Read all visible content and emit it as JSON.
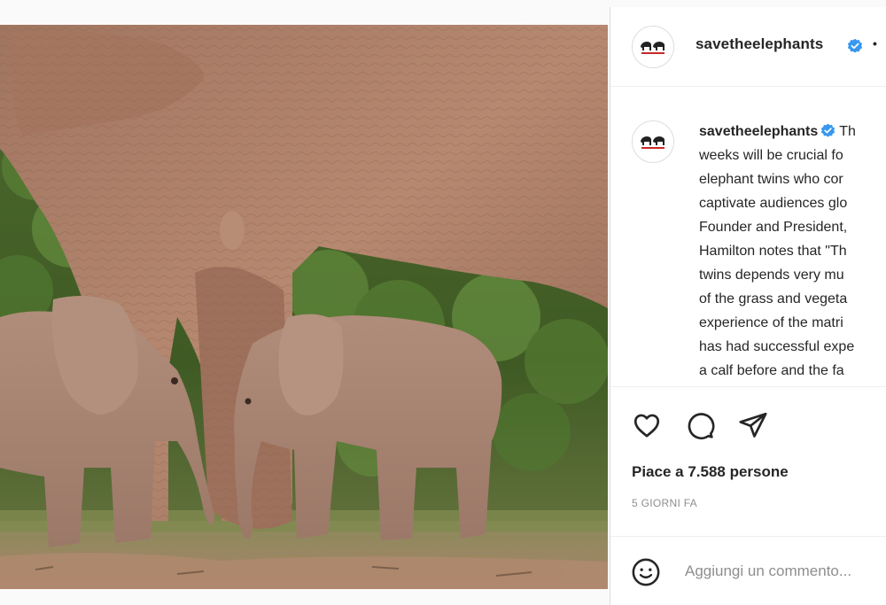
{
  "post": {
    "username": "savetheelephants",
    "separator": "•",
    "image_alt": "Adult elephant standing over two newborn elephant calves in green bush"
  },
  "caption": {
    "username": "savetheelephants",
    "lines": [
      "Th",
      "weeks will be crucial fo",
      "elephant twins who cor",
      "captivate audiences glo",
      "Founder and President,",
      "Hamilton notes that \"Th",
      "twins depends very mu",
      "of the grass and vegeta",
      "experience of the matri",
      "has had successful expe",
      "a calf before and the fa"
    ]
  },
  "actions": {
    "like_icon": "heart-icon",
    "comment_icon": "comment-icon",
    "share_icon": "share-icon"
  },
  "likes": {
    "text": "Piace a 7.588 persone"
  },
  "timestamp": {
    "text": "5 GIORNI FA"
  },
  "comment": {
    "placeholder": "Aggiungi un commento...",
    "emoji_icon": "emoji-icon"
  },
  "colors": {
    "verified": "#3897f0",
    "text": "#262626",
    "muted": "#8e8e8e",
    "border": "#dbdbdb"
  }
}
